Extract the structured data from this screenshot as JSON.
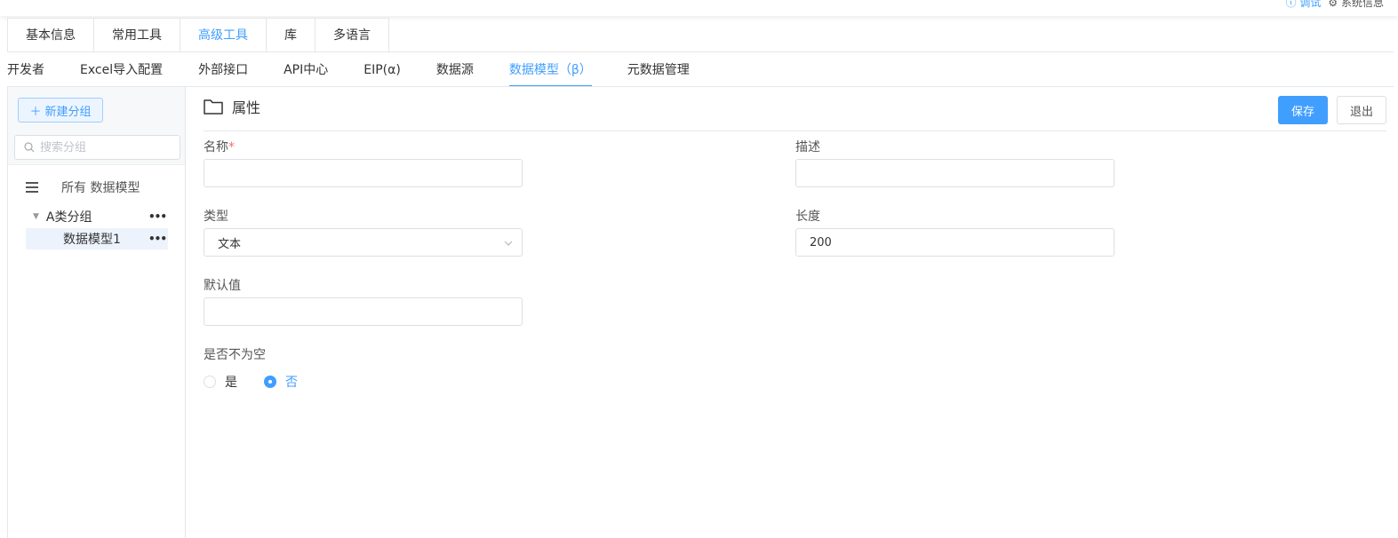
{
  "top": {
    "debug_label": "调试",
    "system_label": "系统信息"
  },
  "tabs1": [
    "基本信息",
    "常用工具",
    "高级工具",
    "库",
    "多语言"
  ],
  "tabs1_active": 2,
  "tabs2": [
    "开发者",
    "Excel导入配置",
    "外部接口",
    "API中心",
    "EIP(α)",
    "数据源",
    "数据模型（β）",
    "元数据管理"
  ],
  "tabs2_active": 6,
  "sidebar": {
    "new_group_label": "新建分组",
    "search_placeholder": "搜索分组",
    "all_label": "所有 数据模型",
    "group_label": "A类分组",
    "item_label": "数据模型1"
  },
  "main": {
    "title": "属性",
    "save_label": "保存",
    "exit_label": "退出",
    "fields": {
      "name_label": "名称",
      "name_value": "",
      "desc_label": "描述",
      "desc_value": "",
      "type_label": "类型",
      "type_value": "文本",
      "length_label": "长度",
      "length_value": "200",
      "default_label": "默认值",
      "default_value": "",
      "notnull_label": "是否不为空",
      "yes_label": "是",
      "no_label": "否",
      "notnull_selected": "否"
    }
  },
  "colors": {
    "accent": "#409eff",
    "required": "#f56c6c"
  }
}
